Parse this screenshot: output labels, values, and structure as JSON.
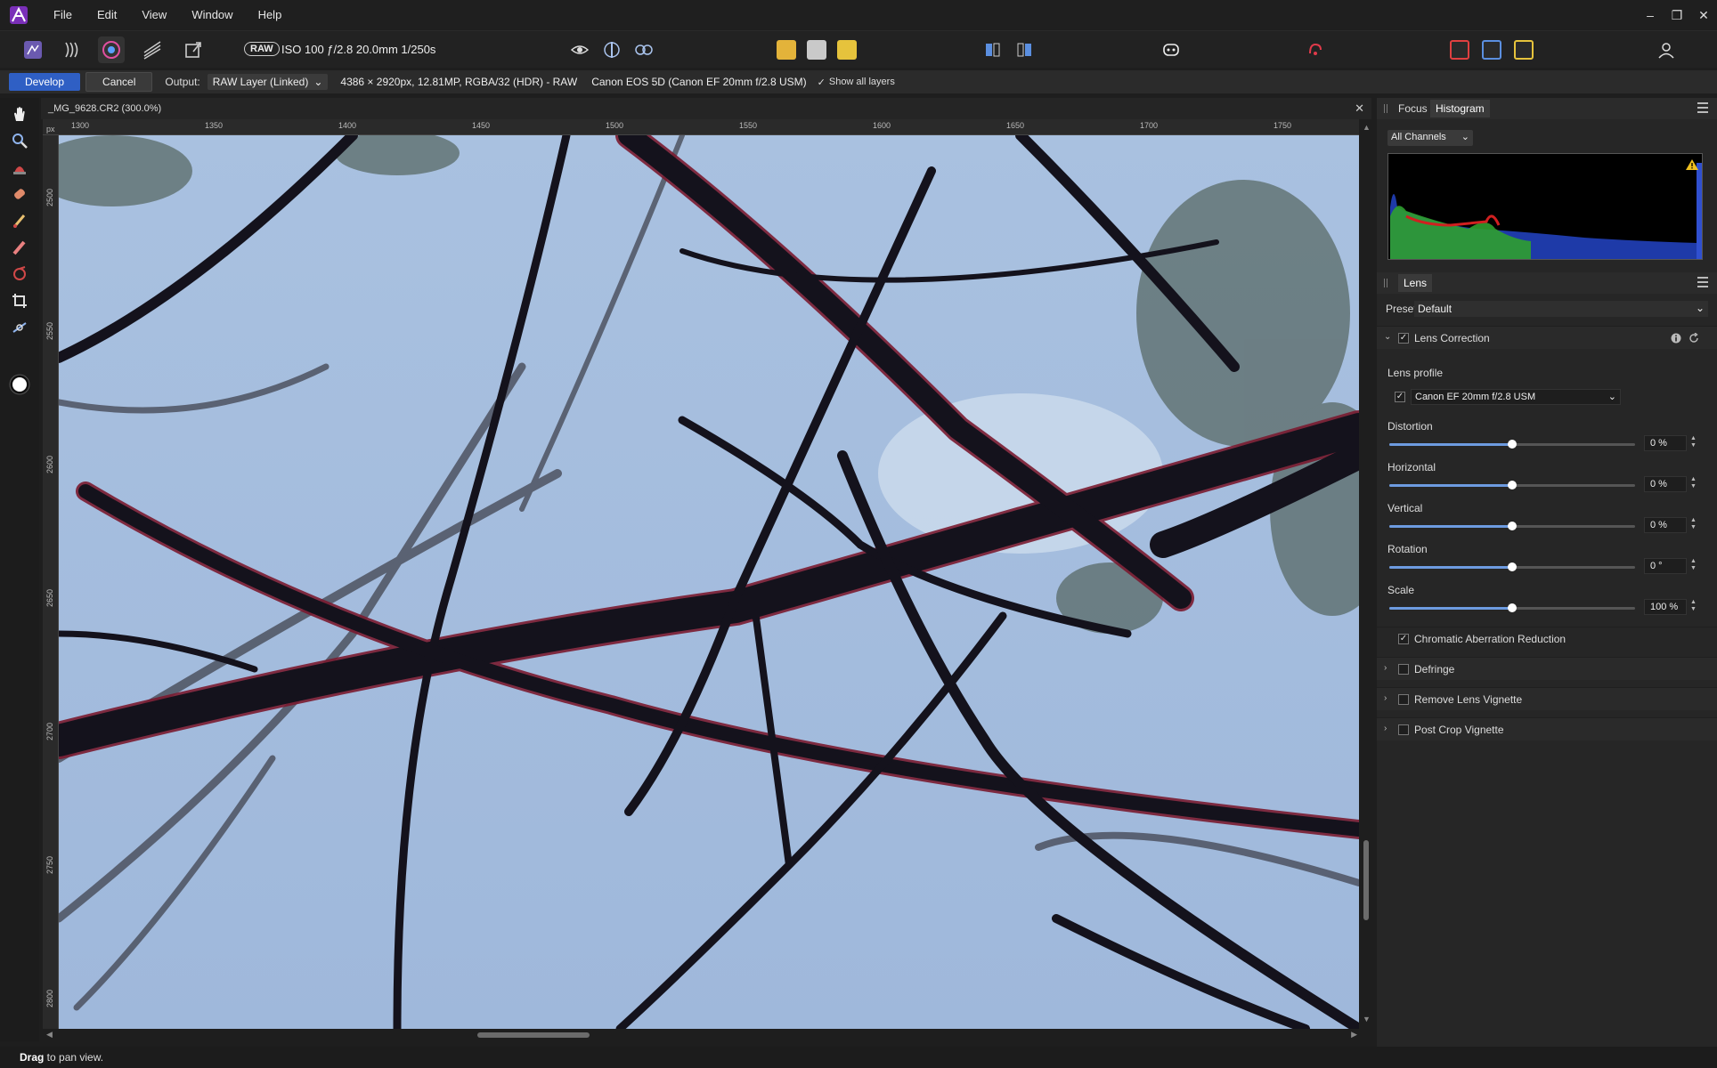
{
  "menubar": {
    "items": [
      "File",
      "Edit",
      "View",
      "Window",
      "Help"
    ],
    "window_controls": [
      "–",
      "❐",
      "✕"
    ]
  },
  "toolbar": {
    "raw_badge": "RAW",
    "exif": "ISO 100 ƒ/2.8 20.0mm 1/250s"
  },
  "context_bar": {
    "develop_label": "Develop",
    "cancel_label": "Cancel",
    "output_label": "Output:",
    "output_value": "RAW Layer (Linked)",
    "image_info": "4386 × 2920px, 12.81MP, RGBA/32 (HDR) - RAW",
    "camera_info": "Canon EOS 5D (Canon EF 20mm f/2.8 USM)",
    "show_all_layers": "Show all layers"
  },
  "document": {
    "title": "_MG_9628.CR2 (300.0%)",
    "close": "✕",
    "ruler_unit": "px",
    "ruler_top_labels": [
      "1300",
      "1350",
      "1400",
      "1450",
      "1500",
      "1550",
      "1600",
      "1650",
      "1700",
      "1750"
    ],
    "ruler_left_labels": [
      "2500",
      "2550",
      "2600",
      "2650",
      "2700",
      "2750",
      "2800"
    ]
  },
  "status": {
    "bold": "Drag",
    "rest": " to pan view."
  },
  "right_panel": {
    "tabs": [
      "Focus",
      "Histogram"
    ],
    "channels": "All Channels",
    "lens_header": "Lens",
    "preset_label": "Preset:",
    "preset_value": "Default",
    "lens_correction": "Lens Correction",
    "lens_profile_label": "Lens profile",
    "lens_profile_value": "Canon EF 20mm f/2.8 USM",
    "sliders": [
      {
        "label": "Distortion",
        "value": "0 %",
        "fraction": 0.5
      },
      {
        "label": "Horizontal",
        "value": "0 %",
        "fraction": 0.5
      },
      {
        "label": "Vertical",
        "value": "0 %",
        "fraction": 0.5
      },
      {
        "label": "Rotation",
        "value": "0 °",
        "fraction": 0.5
      },
      {
        "label": "Scale",
        "value": "100 %",
        "fraction": 0.5
      }
    ],
    "chromatic": "Chromatic Aberration Reduction",
    "sections": [
      "Defringe",
      "Remove Lens Vignette",
      "Post Crop Vignette"
    ]
  },
  "colors": {
    "accent": "#2f5fc4",
    "sky": "#a7bfdd",
    "branch": "#14121c"
  }
}
